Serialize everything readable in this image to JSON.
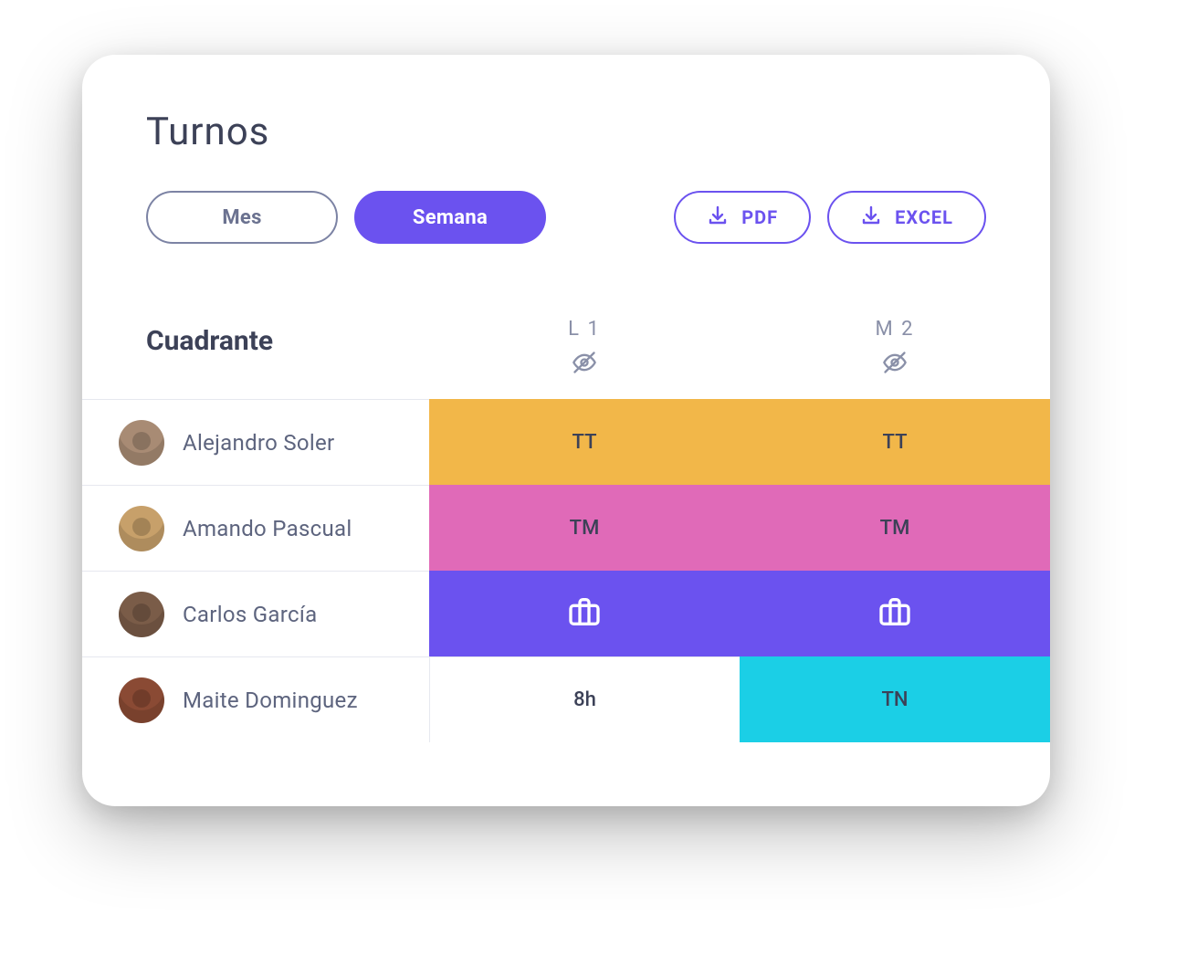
{
  "title": "Turnos",
  "views": {
    "month": "Mes",
    "week": "Semana",
    "active": "week"
  },
  "exports": {
    "pdf": "PDF",
    "excel": "EXCEL"
  },
  "schedule": {
    "label": "Cuadrante",
    "days": [
      {
        "label": "L 1"
      },
      {
        "label": "M 2"
      }
    ],
    "employees": [
      {
        "name": "Alejandro Soler",
        "avatar_bg": "#a88b74",
        "cells": [
          {
            "type": "code",
            "text": "TT",
            "bg": "#f2b749"
          },
          {
            "type": "code",
            "text": "TT",
            "bg": "#f2b749"
          }
        ]
      },
      {
        "name": "Amando Pascual",
        "avatar_bg": "#c7a06a",
        "cells": [
          {
            "type": "code",
            "text": "TM",
            "bg": "#e06ab8"
          },
          {
            "type": "code",
            "text": "TM",
            "bg": "#e06ab8"
          }
        ]
      },
      {
        "name": "Carlos García",
        "avatar_bg": "#7a5c48",
        "cells": [
          {
            "type": "icon",
            "icon": "briefcase",
            "bg": "#6b52ef",
            "fg": "#ffffff"
          },
          {
            "type": "icon",
            "icon": "briefcase",
            "bg": "#6b52ef",
            "fg": "#ffffff"
          }
        ]
      },
      {
        "name": "Maite Dominguez",
        "avatar_bg": "#8a4a34",
        "cells": [
          {
            "type": "plain",
            "text": "8h"
          },
          {
            "type": "code",
            "text": "TN",
            "bg": "#1bcfe6"
          }
        ]
      }
    ]
  }
}
